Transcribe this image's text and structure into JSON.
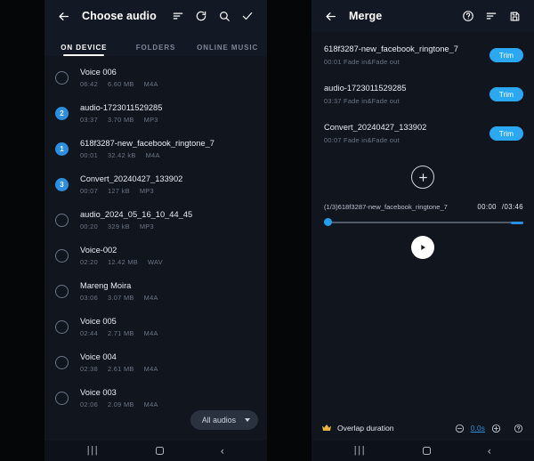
{
  "left_panel": {
    "appbar": {
      "back_icon": "arrow-left-icon",
      "title": "Choose audio",
      "actions": [
        {
          "icon": "sort-icon",
          "name": "sort-button"
        },
        {
          "icon": "refresh-icon",
          "name": "refresh-button"
        },
        {
          "icon": "search-icon",
          "name": "search-button"
        },
        {
          "icon": "check-icon",
          "name": "confirm-button"
        }
      ]
    },
    "tabs": [
      {
        "label": "ON DEVICE",
        "active": true
      },
      {
        "label": "FOLDERS",
        "active": false
      },
      {
        "label": "ONLINE MUSIC",
        "active": false
      }
    ],
    "files": [
      {
        "title": "Voice 006",
        "duration": "06:42",
        "size": "6.60 MB",
        "format": "M4A",
        "selection": ""
      },
      {
        "title": "audio-1723011529285",
        "duration": "03:37",
        "size": "3.70 MB",
        "format": "MP3",
        "selection": "2"
      },
      {
        "title": "618f3287-new_facebook_ringtone_7",
        "duration": "00:01",
        "size": "32.42 kB",
        "format": "M4A",
        "selection": "1"
      },
      {
        "title": "Convert_20240427_133902",
        "duration": "00:07",
        "size": "127 kB",
        "format": "MP3",
        "selection": "3"
      },
      {
        "title": "audio_2024_05_16_10_44_45",
        "duration": "00:20",
        "size": "329 kB",
        "format": "MP3",
        "selection": ""
      },
      {
        "title": "Voice-002",
        "duration": "02:20",
        "size": "12.42 MB",
        "format": "WAV",
        "selection": ""
      },
      {
        "title": "Mareng Moira",
        "duration": "03:06",
        "size": "3.07 MB",
        "format": "M4A",
        "selection": ""
      },
      {
        "title": "Voice 005",
        "duration": "02:44",
        "size": "2.71 MB",
        "format": "M4A",
        "selection": ""
      },
      {
        "title": "Voice 004",
        "duration": "02:38",
        "size": "2.61 MB",
        "format": "M4A",
        "selection": ""
      },
      {
        "title": "Voice 003",
        "duration": "02:06",
        "size": "2.09 MB",
        "format": "M4A",
        "selection": ""
      }
    ],
    "filter": {
      "label": "All audios",
      "icon": "chevron-down-icon"
    },
    "navbar": {
      "recents": "|||",
      "home_icon": "home-square-icon",
      "back": "‹"
    }
  },
  "right_panel": {
    "appbar": {
      "back_icon": "arrow-left-icon",
      "title": "Merge",
      "actions": [
        {
          "icon": "help-circle-icon",
          "name": "help-button"
        },
        {
          "icon": "sort-icon",
          "name": "sort-button"
        },
        {
          "icon": "save-icon",
          "name": "save-button"
        }
      ]
    },
    "tracks": [
      {
        "title": "618f3287-new_facebook_ringtone_7",
        "meta": "00:01  Fade in&Fade out",
        "trim_label": "Trim"
      },
      {
        "title": "audio-1723011529285",
        "meta": "03:37  Fade in&Fade out",
        "trim_label": "Trim"
      },
      {
        "title": "Convert_20240427_133902",
        "meta": "00:07  Fade in&Fade out",
        "trim_label": "Trim"
      }
    ],
    "player": {
      "add_icon": "plus-circle-icon",
      "now_playing": "(1/3)618f3287-new_facebook_ringtone_7",
      "current_time": "00:00",
      "total_time": "/03:46",
      "progress_percent": 0,
      "play_icon": "play-icon"
    },
    "overlap": {
      "crown_icon": "crown-icon",
      "label": "Overlap duration",
      "minus_icon": "minus-circle-icon",
      "value": "0.0s",
      "plus_icon": "plus-circle-icon",
      "help_icon": "help-circle-icon"
    },
    "navbar": {
      "recents": "|||",
      "home_icon": "home-square-icon",
      "back": "‹"
    }
  },
  "colors": {
    "accent_blue": "#2aa8f2",
    "selection_blue": "#2a8fe0",
    "panel_bg": "#10151e",
    "appbar_bg": "#131924",
    "crown_gold": "#e8b23c"
  }
}
